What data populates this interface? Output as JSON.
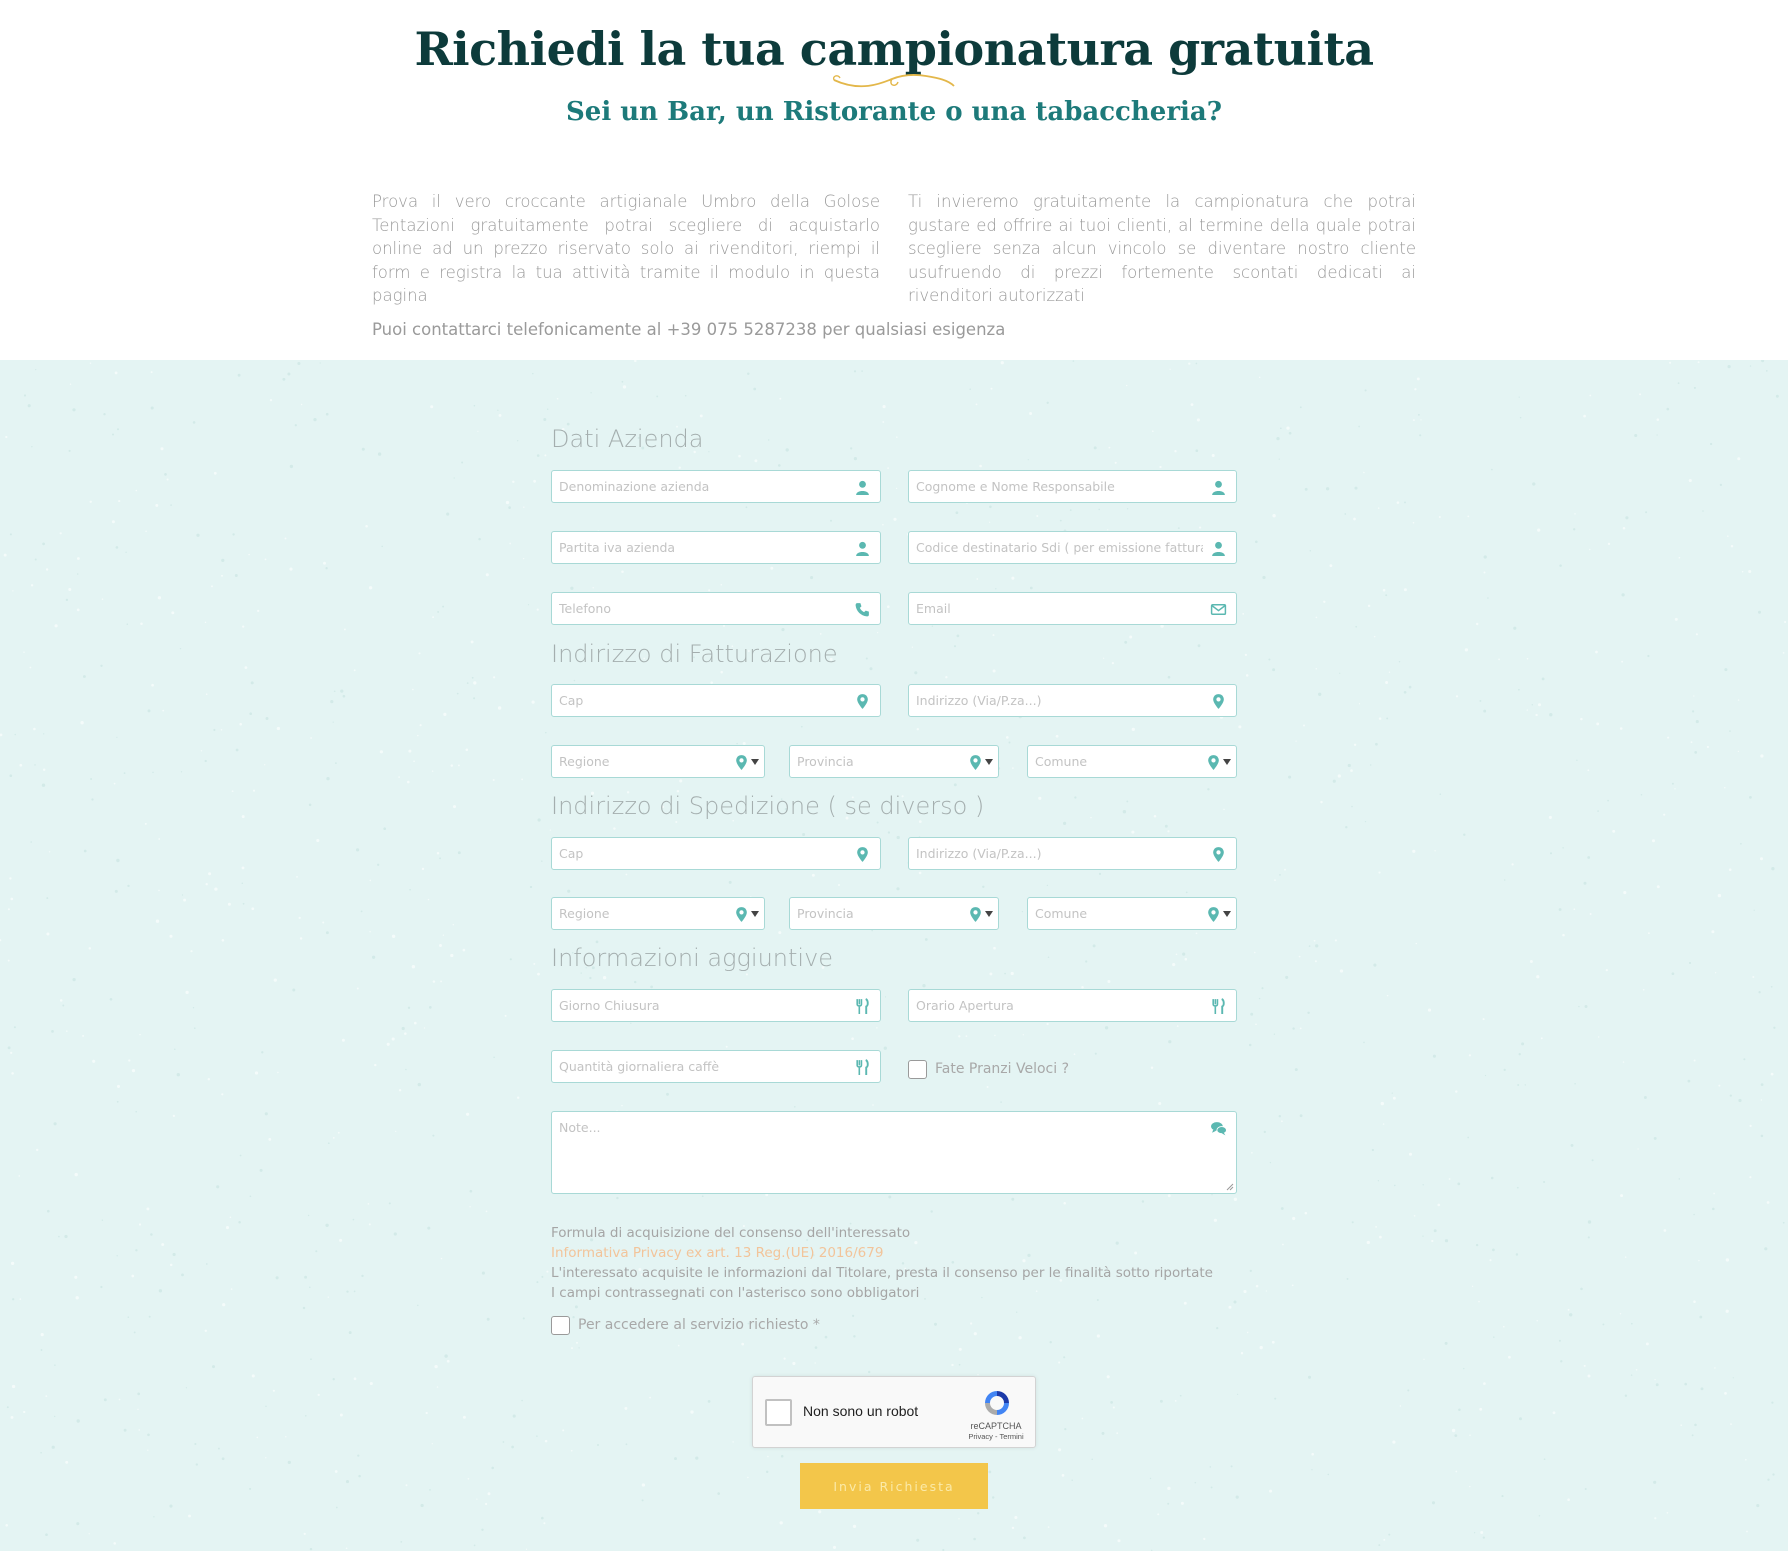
{
  "header": {
    "title": "Richiedi la tua campionatura gratuita",
    "subtitle": "Sei un Bar, un Ristorante o una tabaccheria?"
  },
  "intro": {
    "left": "Prova il vero croccante artigianale Umbro della Golose Tentazioni gratuitamente potrai scegliere di acquistarlo online ad un prezzo riservato solo ai rivenditori, riempi il form e registra la tua attività tramite il modulo in questa pagina",
    "right": "Ti invieremo gratuitamente la campionatura che potrai gustare ed offrire ai tuoi clienti, al termine della quale potrai scegliere senza alcun vincolo se diventare nostro cliente usufruendo di prezzi fortemente scontati dedicati ai rivenditori autorizzati",
    "contact": "Puoi contattarci telefonicamente al +39 075 5287238 per qualsiasi esigenza"
  },
  "sections": {
    "company": "Dati Azienda",
    "billing": "Indirizzo di Fatturazione",
    "shipping": "Indirizzo di Spedizione ( se diverso )",
    "extra": "Informazioni aggiuntive"
  },
  "fields": {
    "company_name": "Denominazione azienda",
    "manager_name": "Cognome e Nome Responsabile",
    "vat": "Partita iva azienda",
    "sdi_code": "Codice destinatario Sdi ( per emissione fattura )",
    "phone": "Telefono",
    "email": "Email",
    "billing_cap": "Cap",
    "billing_address": "Indirizzo (Via/P.za...)",
    "billing_region": "Regione",
    "billing_province": "Provincia",
    "billing_city": "Comune",
    "shipping_cap": "Cap",
    "shipping_address": "Indirizzo (Via/P.za...)",
    "shipping_region": "Regione",
    "shipping_province": "Provincia",
    "shipping_city": "Comune",
    "closing_day": "Giorno Chiusura",
    "opening_hours": "Orario Apertura",
    "daily_coffee": "Quantità giornaliera caffè",
    "quick_lunch": "Fate Pranzi Veloci ?",
    "notes": "Note..."
  },
  "consent": {
    "heading": "Formula di acquisizione del consenso dell'interessato",
    "link": "Informativa Privacy ex art. 13 Reg.(UE) 2016/679",
    "line1": "L'interessato acquisite le informazioni dal Titolare, presta il consenso per le finalità sotto riportate",
    "line2": "I campi contrassegnati con l'asterisco sono obbligatori",
    "checkbox_label": "Per accedere al servizio richiesto *"
  },
  "recaptcha": {
    "label": "Non sono un robot",
    "brand": "reCAPTCHA",
    "terms": "Privacy - Termini"
  },
  "submit_label": "Invia Richiesta",
  "colors": {
    "accent": "#f3c64a",
    "teal": "#1d7a7a",
    "form_bg": "#e4f4f3",
    "field_border": "#a8d9d6",
    "icon": "#5bb8b1"
  },
  "icons": {
    "user": "user-icon",
    "phone": "phone-icon",
    "email": "envelope-icon",
    "location": "map-marker-icon",
    "cutlery": "cutlery-icon",
    "comments": "comments-icon"
  }
}
